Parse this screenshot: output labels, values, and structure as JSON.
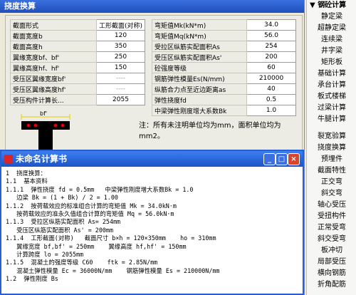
{
  "main": {
    "title": "挠度换算"
  },
  "left_params": [
    {
      "label": "截面形式",
      "value": "工形截面(对称)",
      "disabled": false
    },
    {
      "label": "截面宽度b",
      "value": "120",
      "disabled": false
    },
    {
      "label": "截面高度h",
      "value": "350",
      "disabled": false
    },
    {
      "label": "翼缘宽度bf、bf'",
      "value": "250",
      "disabled": false
    },
    {
      "label": "翼缘高度hf、hf'",
      "value": "150",
      "disabled": false
    },
    {
      "label": "受压区翼缘宽度bf'",
      "value": "----",
      "disabled": true
    },
    {
      "label": "受压区翼缘高度hf'",
      "value": "----",
      "disabled": true
    },
    {
      "label": "受压构件计算长...",
      "value": "2055",
      "disabled": false
    }
  ],
  "right_params": [
    {
      "label": "弯矩值Mk(kN*m)",
      "value": "34.0"
    },
    {
      "label": "弯矩值Mq(kN*m)",
      "value": "56.0"
    },
    {
      "label": "受拉区纵筋实配面积As",
      "value": "254"
    },
    {
      "label": "受压区纵筋实配面积As'",
      "value": "200"
    },
    {
      "label": "砼强度等级",
      "value": "60"
    },
    {
      "label": "钢筋弹性模量Es(N/mm)",
      "value": "210000"
    },
    {
      "label": "纵筋合力点至近边距离as",
      "value": "40"
    },
    {
      "label": "弹性挠度fd",
      "value": "0.5"
    },
    {
      "label": "中梁弹性刚度增大系数Bk",
      "value": "1.0"
    }
  ],
  "diagram": {
    "label": "bf'"
  },
  "note": "注：所有未注明单位均为mm，面积单位均为mm2。",
  "child": {
    "title": "未命名计算书",
    "lines": [
      "1  挠度换算：",
      "1.1  基本资料",
      "1.1.1  弹性挠度 fd = 0.5mm   中梁弹性刚度增大系数Bk = 1.0",
      "   边梁 Bk = (1 + Bk) / 2 = 1.00",
      "1.1.2  按荷载效应的标准组合计算的弯矩值 Mk = 34.0kN·m",
      "   按荷载效应的准永久值组合计算的弯矩值 Mq = 56.0kN·m",
      "1.1.3  受拉区纵筋实配面积 As= 254mm",
      "   受压区纵筋实配面积 As' = 200mm",
      "1.1.4  工形截面(对称)   截面尺寸 b×h = 120×350mm    ho = 310mm",
      "   翼缘宽度 bf,bf' = 250mm    翼缘高度 hf,hf' = 150mm",
      "   计算跨度 lo = 2055mm",
      "1.1.5  混凝土的强度等级 C60    ftk = 2.85N/mm",
      "   混凝土弹性模量 Ec = 36000N/mm    钢筋弹性模量 Es = 210000N/mm",
      "",
      "1.2  弹性刚度 Bs"
    ]
  },
  "sidebar": {
    "group1_title": "钢砼计算",
    "group1": [
      "静定梁",
      "超静定梁",
      "连续梁",
      "井字梁",
      "矩形板",
      "基础计算",
      "承台计算",
      "板式楼梯",
      "过梁计算",
      "牛腿计算"
    ],
    "group2": [
      "裂宽验算",
      "挠度换算",
      "预埋件",
      "截面特性",
      "正交弯",
      "斜交弯",
      "轴心受压",
      "受扭构件",
      "正常受弯",
      "斜交受弯",
      "板冲切",
      "局部受压",
      "横向钢筋",
      "折角配筋"
    ]
  },
  "colors": {
    "titlebar": "#2a5fd0",
    "window_bg": "#ece9d8"
  }
}
